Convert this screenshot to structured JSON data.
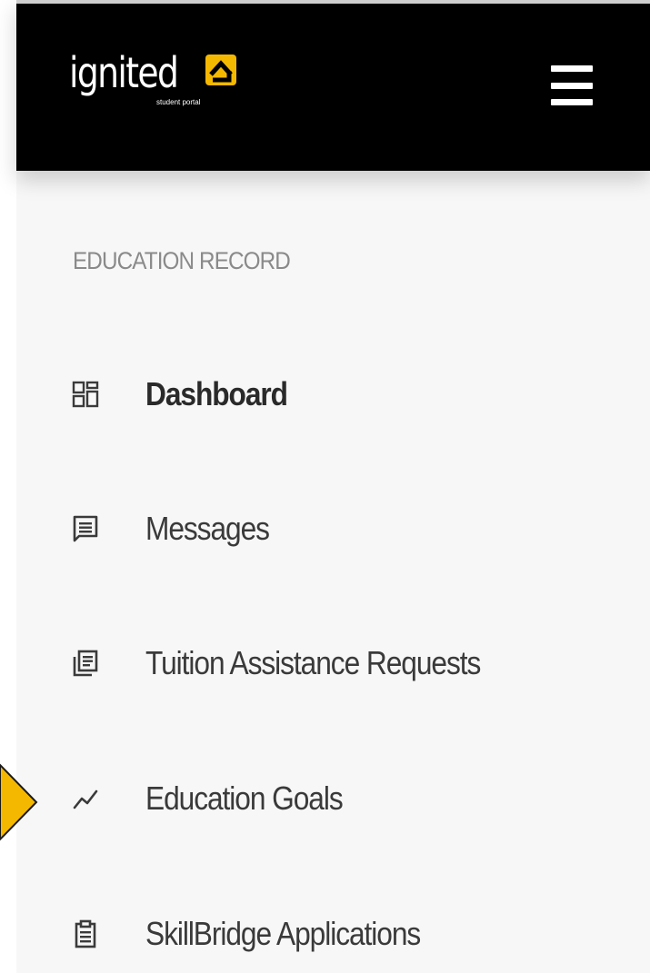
{
  "brand": {
    "wordmark": "ignited",
    "tagline": "student portal",
    "accent_color": "#f5b800",
    "mark_icon": "house-bracket-icon"
  },
  "header": {
    "background": "#000000",
    "menu_icon": "hamburger-menu-icon"
  },
  "sidebar": {
    "section_label": "EDUCATION RECORD",
    "items": [
      {
        "label": "Dashboard",
        "icon": "dashboard-grid-icon",
        "active": true
      },
      {
        "label": "Messages",
        "icon": "message-icon",
        "active": false
      },
      {
        "label": "Tuition Assistance Requests",
        "icon": "documents-icon",
        "active": false
      },
      {
        "label": "Education Goals",
        "icon": "trend-line-icon",
        "active": false
      },
      {
        "label": "SkillBridge Applications",
        "icon": "clipboard-icon",
        "active": false
      }
    ]
  },
  "annotation": {
    "pointer_color": "#f5b800",
    "target": "Education Goals"
  }
}
